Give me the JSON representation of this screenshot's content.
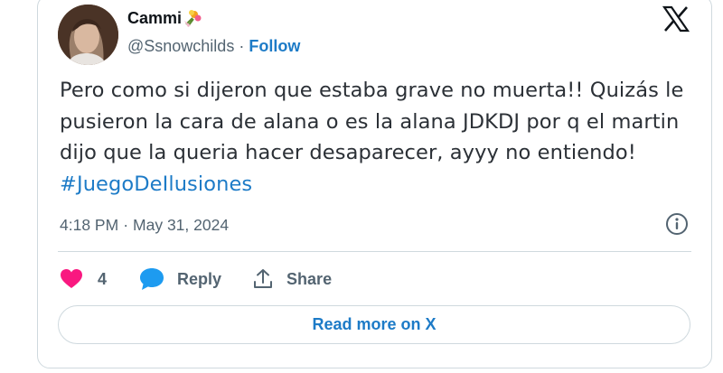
{
  "author": {
    "name": "Cammi",
    "emoji": "bouquet-emoji",
    "handle": "@Ssnowchilds",
    "separator": "·",
    "follow_label": "Follow"
  },
  "tweet": {
    "text": "Pero como si dijeron que estaba grave no muerta!! Quizás le pusieron la cara de alana o es la alana JDKDJ por q el martin dijo que la queria hacer desaparecer, ayyy no entiendo! ",
    "hashtag": "#JuegoDeIlusiones",
    "time": "4:18 PM",
    "separator": "·",
    "date": "May 31, 2024"
  },
  "actions": {
    "like_count": "4",
    "reply_label": "Reply",
    "share_label": "Share"
  },
  "read_more_label": "Read more on X",
  "icons": {
    "brand": "x-logo-icon",
    "info": "info-icon",
    "like": "heart-icon",
    "reply": "speech-bubble-icon",
    "share": "share-upload-icon"
  },
  "colors": {
    "link": "#1d7bc7",
    "heart": "#f91880",
    "muted": "#536471",
    "border": "#cfd9de"
  }
}
